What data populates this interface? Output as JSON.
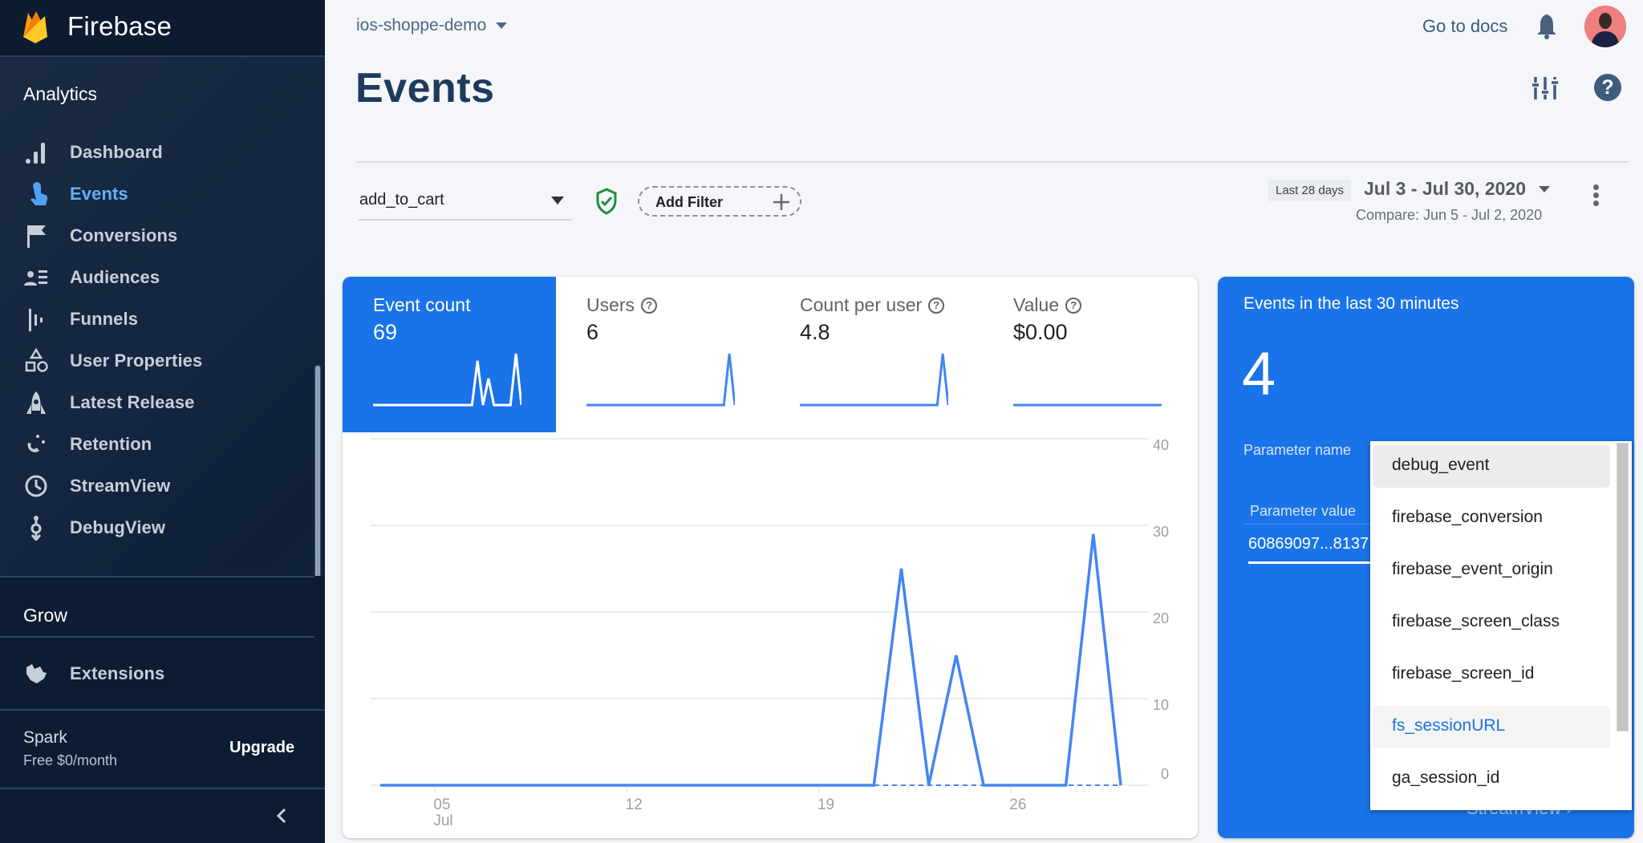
{
  "sidebar": {
    "brand": "Firebase",
    "section_analytics": "Analytics",
    "items": [
      {
        "label": "Dashboard",
        "icon": "bar-chart-icon",
        "active": false
      },
      {
        "label": "Events",
        "icon": "touch-icon",
        "active": true
      },
      {
        "label": "Conversions",
        "icon": "flag-icon",
        "active": false
      },
      {
        "label": "Audiences",
        "icon": "audience-icon",
        "active": false
      },
      {
        "label": "Funnels",
        "icon": "funnel-icon",
        "active": false
      },
      {
        "label": "User Properties",
        "icon": "shapes-icon",
        "active": false
      },
      {
        "label": "Latest Release",
        "icon": "rocket-icon",
        "active": false
      },
      {
        "label": "Retention",
        "icon": "magnet-icon",
        "active": false
      },
      {
        "label": "StreamView",
        "icon": "clock-icon",
        "active": false
      },
      {
        "label": "DebugView",
        "icon": "debug-icon",
        "active": false
      }
    ],
    "section_grow": "Grow",
    "extensions": "Extensions",
    "plan_name": "Spark",
    "plan_price": "Free $0/month",
    "upgrade": "Upgrade"
  },
  "header": {
    "project": "ios-shoppe-demo",
    "go_to_docs": "Go to docs",
    "page_title": "Events"
  },
  "filters": {
    "event": "add_to_cart",
    "add_filter": "Add Filter",
    "range_chip": "Last 28 days",
    "date_range": "Jul 3 - Jul 30, 2020",
    "compare": "Compare: Jun 5 - Jul 2, 2020"
  },
  "colors": {
    "accent": "#1a73e8",
    "line": "#4285f4",
    "sidebar": "#142640",
    "active_nav": "#63b0f6",
    "shield": "#1e8e3e"
  },
  "metrics": [
    {
      "label": "Event count",
      "value": "69",
      "help": false,
      "active": true,
      "spark": [
        0,
        0,
        0,
        0,
        0,
        0,
        0,
        0,
        0,
        0,
        0,
        0,
        0,
        0,
        0,
        0,
        0,
        0,
        0,
        25,
        0,
        15,
        0,
        0,
        0,
        0,
        29,
        0
      ]
    },
    {
      "label": "Users",
      "value": "6",
      "help": true,
      "active": false,
      "spark": [
        0,
        0,
        0,
        0,
        0,
        0,
        0,
        0,
        0,
        0,
        0,
        0,
        0,
        0,
        0,
        0,
        0,
        0,
        0,
        0,
        0,
        0,
        0,
        0,
        0,
        0,
        6,
        0
      ]
    },
    {
      "label": "Count per user",
      "value": "4.8",
      "help": true,
      "active": false,
      "spark": [
        0,
        0,
        0,
        0,
        0,
        0,
        0,
        0,
        0,
        0,
        0,
        0,
        0,
        0,
        0,
        0,
        0,
        0,
        0,
        0,
        0,
        0,
        0,
        0,
        0,
        0,
        4.8,
        0
      ]
    },
    {
      "label": "Value",
      "value": "$0.00",
      "help": true,
      "active": false,
      "spark": [
        0,
        0,
        0,
        0,
        0,
        0,
        0,
        0,
        0,
        0,
        0,
        0,
        0,
        0,
        0,
        0,
        0,
        0,
        0,
        0,
        0,
        0,
        0,
        0,
        0,
        0,
        0,
        0
      ]
    }
  ],
  "chart_data": {
    "type": "line",
    "title": "Event count",
    "x": [
      "Jul 3",
      "Jul 4",
      "Jul 5",
      "Jul 6",
      "Jul 7",
      "Jul 8",
      "Jul 9",
      "Jul 10",
      "Jul 11",
      "Jul 12",
      "Jul 13",
      "Jul 14",
      "Jul 15",
      "Jul 16",
      "Jul 17",
      "Jul 18",
      "Jul 19",
      "Jul 20",
      "Jul 21",
      "Jul 22",
      "Jul 23",
      "Jul 24",
      "Jul 25",
      "Jul 26",
      "Jul 27",
      "Jul 28",
      "Jul 29",
      "Jul 30"
    ],
    "series": [
      {
        "name": "add_to_cart event count",
        "values": [
          0,
          0,
          0,
          0,
          0,
          0,
          0,
          0,
          0,
          0,
          0,
          0,
          0,
          0,
          0,
          0,
          0,
          0,
          0,
          25,
          0,
          15,
          0,
          0,
          0,
          0,
          29,
          0
        ]
      }
    ],
    "x_ticks": [
      {
        "index": 2,
        "label": "05",
        "sublabel": "Jul"
      },
      {
        "index": 9,
        "label": "12"
      },
      {
        "index": 16,
        "label": "19"
      },
      {
        "index": 23,
        "label": "26"
      }
    ],
    "y_ticks": [
      0,
      10,
      20,
      30,
      40
    ],
    "ylim": [
      0,
      40
    ],
    "yaxis_position": "right",
    "grid": true,
    "xlabel": "",
    "ylabel": ""
  },
  "realtime": {
    "title": "Events in the last 30 minutes",
    "count": "4",
    "param_name_label": "Parameter name",
    "param_value_label": "Parameter value",
    "param_value": "60869097...8137",
    "streamview_link": "StreamView",
    "dropdown_options": [
      {
        "label": "debug_event",
        "state": "focused"
      },
      {
        "label": "firebase_conversion",
        "state": ""
      },
      {
        "label": "firebase_event_origin",
        "state": ""
      },
      {
        "label": "firebase_screen_class",
        "state": ""
      },
      {
        "label": "firebase_screen_id",
        "state": ""
      },
      {
        "label": "fs_sessionURL",
        "state": "highlighted"
      },
      {
        "label": "ga_session_id",
        "state": ""
      }
    ]
  }
}
